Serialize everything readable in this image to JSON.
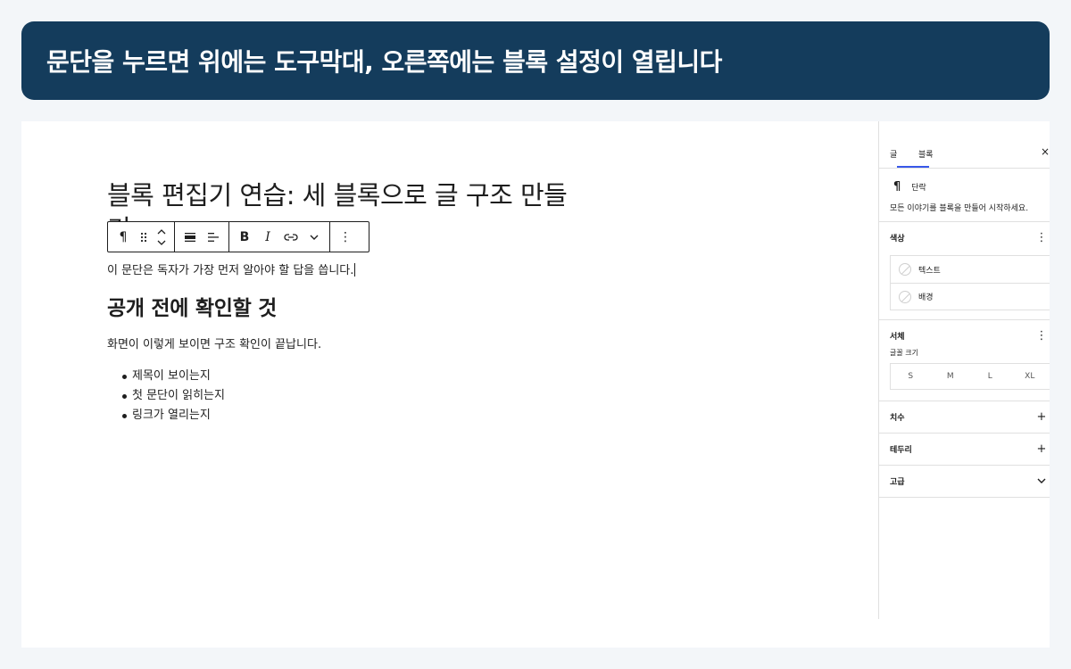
{
  "banner": {
    "text": "문단을 누르면 위에는 도구막대, 오른쪽에는 블록 설정이 열립니다"
  },
  "editor": {
    "title": "블록 편집기 연습: 세 블록으로 글 구조 만들기",
    "paragraph1": "이 문단은 독자가 가장 먼저 알아야 할 답을 씁니다.",
    "heading": "공개 전에 확인할 것",
    "paragraph2": "화면이 이렇게 보이면 구조 확인이 끝납니다.",
    "list": [
      "제목이 보이는지",
      "첫 문단이 읽히는지",
      "링크가 열리는지"
    ]
  },
  "toolbar": {
    "paragraph_icon": "¶",
    "bold": "B",
    "italic": "I",
    "more": "⋮",
    "icons": [
      "pilcrow-icon",
      "drag-handle-icon",
      "move-up-icon",
      "move-down-icon",
      "align-wide-icon",
      "align-left-icon",
      "bold-icon",
      "italic-icon",
      "link-icon",
      "chevron-down-icon",
      "more-vertical-icon"
    ]
  },
  "sidebar": {
    "tabs": [
      "글",
      "블록"
    ],
    "active_tab": "블록",
    "close": "×",
    "block_card": {
      "icon": "¶",
      "title": "단락",
      "description": "모든 이야기를 블록을 만들어 시작하세요."
    },
    "color_panel": {
      "title": "색상",
      "items": [
        "텍스트",
        "배경"
      ]
    },
    "typography_panel": {
      "title": "서체",
      "font_size_label": "글꼴 크기",
      "sizes": [
        "S",
        "M",
        "L",
        "XL"
      ]
    },
    "dimensions_panel": {
      "title": "치수"
    },
    "border_panel": {
      "title": "테두리"
    },
    "advanced_panel": {
      "title": "고급"
    },
    "plus": "+",
    "kebab": "⋮"
  },
  "colors": {
    "banner": "#143c5c",
    "accent": "#3858e9",
    "text": "#1e1e1e"
  }
}
